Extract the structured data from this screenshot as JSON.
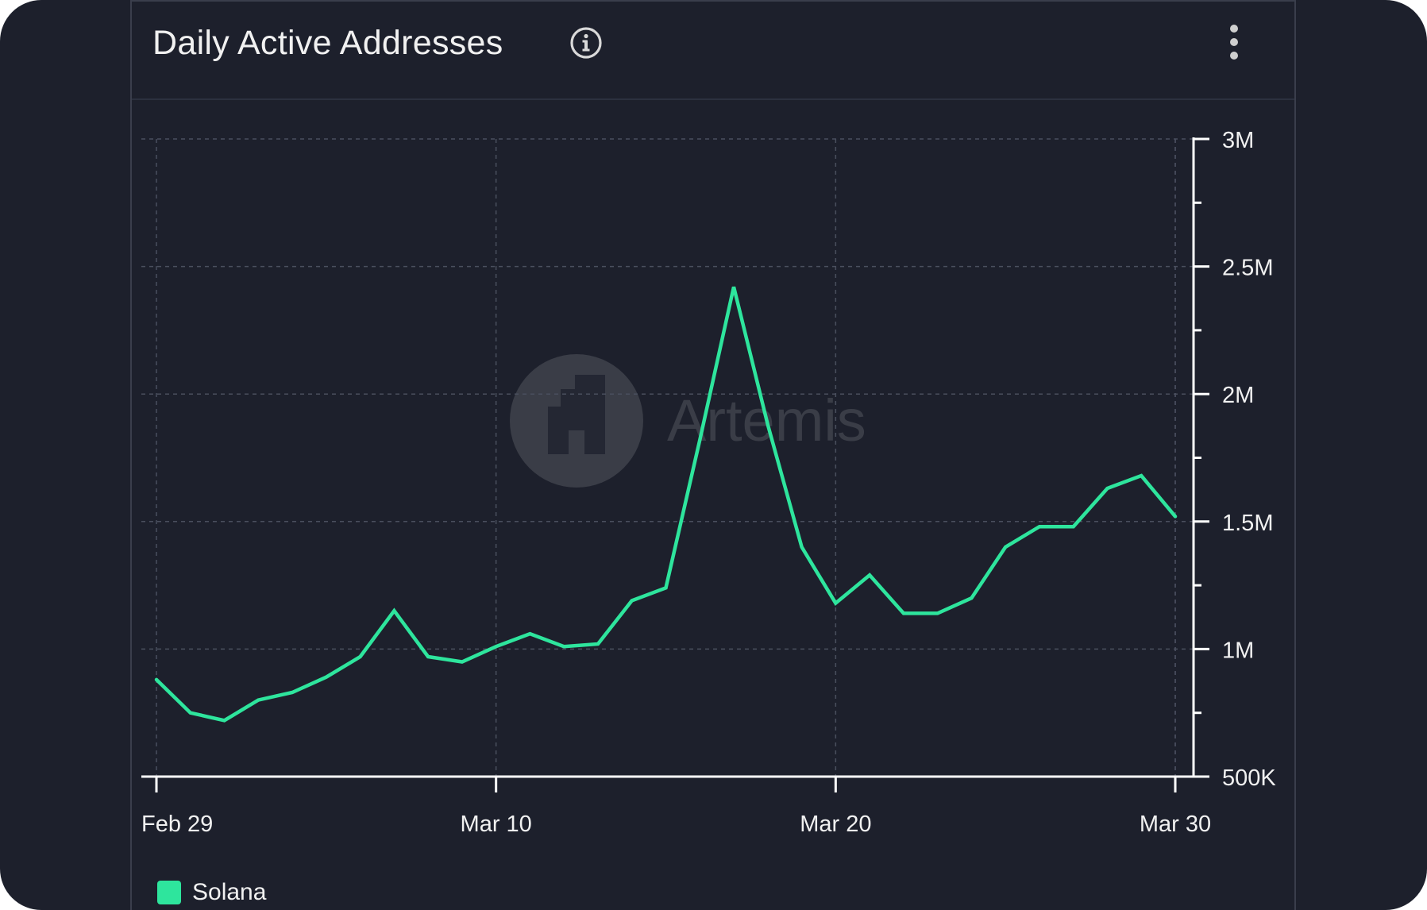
{
  "card": {
    "title": "Daily Active Addresses"
  },
  "icons": {
    "info": "info-icon",
    "menu": "kebab-menu-icon",
    "watermark": "artemis-logo"
  },
  "watermark": {
    "text": "Artemis"
  },
  "colors": {
    "background": "#1d202c",
    "series": "#2ee59d",
    "grid": "#4a4f5e",
    "axis": "#ffffff",
    "text": "#f1f1f1"
  },
  "chart_data": {
    "type": "line",
    "title": "Daily Active Addresses",
    "xlabel": "",
    "ylabel": "",
    "x_tick_labels": [
      "Feb 29",
      "Mar 10",
      "Mar 20",
      "Mar 30"
    ],
    "y_tick_labels": [
      "500K",
      "1M",
      "1.5M",
      "2M",
      "2.5M",
      "3M"
    ],
    "y_ticks": [
      500000,
      1000000,
      1500000,
      2000000,
      2500000,
      3000000
    ],
    "ylim": [
      500000,
      3000000
    ],
    "x": [
      "2024-02-29",
      "2024-03-01",
      "2024-03-02",
      "2024-03-03",
      "2024-03-04",
      "2024-03-05",
      "2024-03-06",
      "2024-03-07",
      "2024-03-08",
      "2024-03-09",
      "2024-03-10",
      "2024-03-11",
      "2024-03-12",
      "2024-03-13",
      "2024-03-14",
      "2024-03-15",
      "2024-03-16",
      "2024-03-17",
      "2024-03-18",
      "2024-03-19",
      "2024-03-20",
      "2024-03-21",
      "2024-03-22",
      "2024-03-23",
      "2024-03-24",
      "2024-03-25",
      "2024-03-26",
      "2024-03-27",
      "2024-03-28",
      "2024-03-29",
      "2024-03-30"
    ],
    "grid": true,
    "legend_position": "bottom-left",
    "series": [
      {
        "name": "Solana",
        "color": "#2ee59d",
        "values": [
          880000,
          750000,
          720000,
          800000,
          830000,
          890000,
          970000,
          1150000,
          970000,
          950000,
          1010000,
          1060000,
          1010000,
          1020000,
          1190000,
          1240000,
          1820000,
          2420000,
          1880000,
          1400000,
          1180000,
          1290000,
          1140000,
          1140000,
          1200000,
          1400000,
          1480000,
          1480000,
          1630000,
          1680000,
          1520000
        ]
      }
    ]
  }
}
